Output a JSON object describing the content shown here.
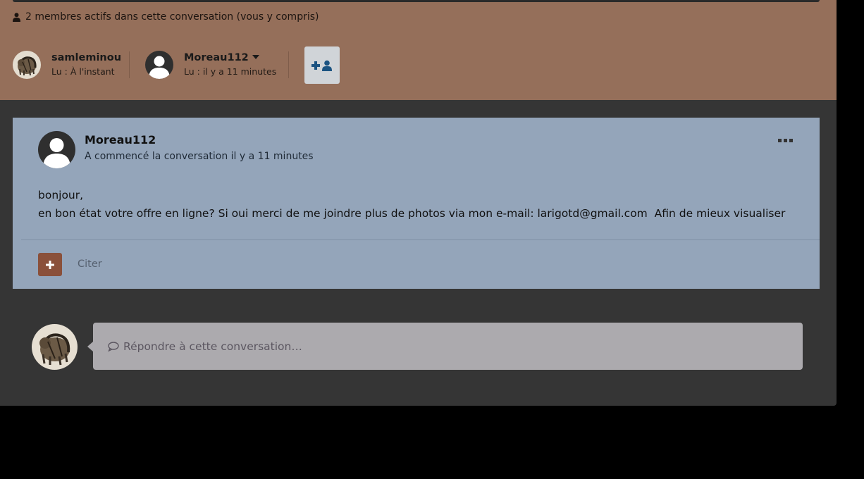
{
  "header": {
    "active_members": "2 membres actifs dans cette conversation (vous y compris)",
    "members": [
      {
        "name": "samleminou",
        "read": "Lu : À l'instant",
        "avatar_icon": "cat-avatar-icon"
      },
      {
        "name": "Moreau112",
        "read": "Lu : il y a 11 minutes",
        "avatar_icon": "default-user-avatar-icon"
      }
    ],
    "add_member_icon": "add-user-icon",
    "background_color": "#956f5a"
  },
  "post": {
    "author": "Moreau112",
    "meta": "A commencé la conversation il y a 11 minutes",
    "body_lines": [
      "bonjour,",
      "en bon état votre offre en ligne? Si oui merci de me joindre plus de photos via mon e-mail: larigotd@gmail.com  Afin de mieux visualiser"
    ],
    "quote_label": "Citer",
    "menu_icon": "ellipsis-icon",
    "background_color": "#94a5ba"
  },
  "reply": {
    "placeholder": "Répondre à cette conversation…",
    "icon": "comment-icon"
  }
}
